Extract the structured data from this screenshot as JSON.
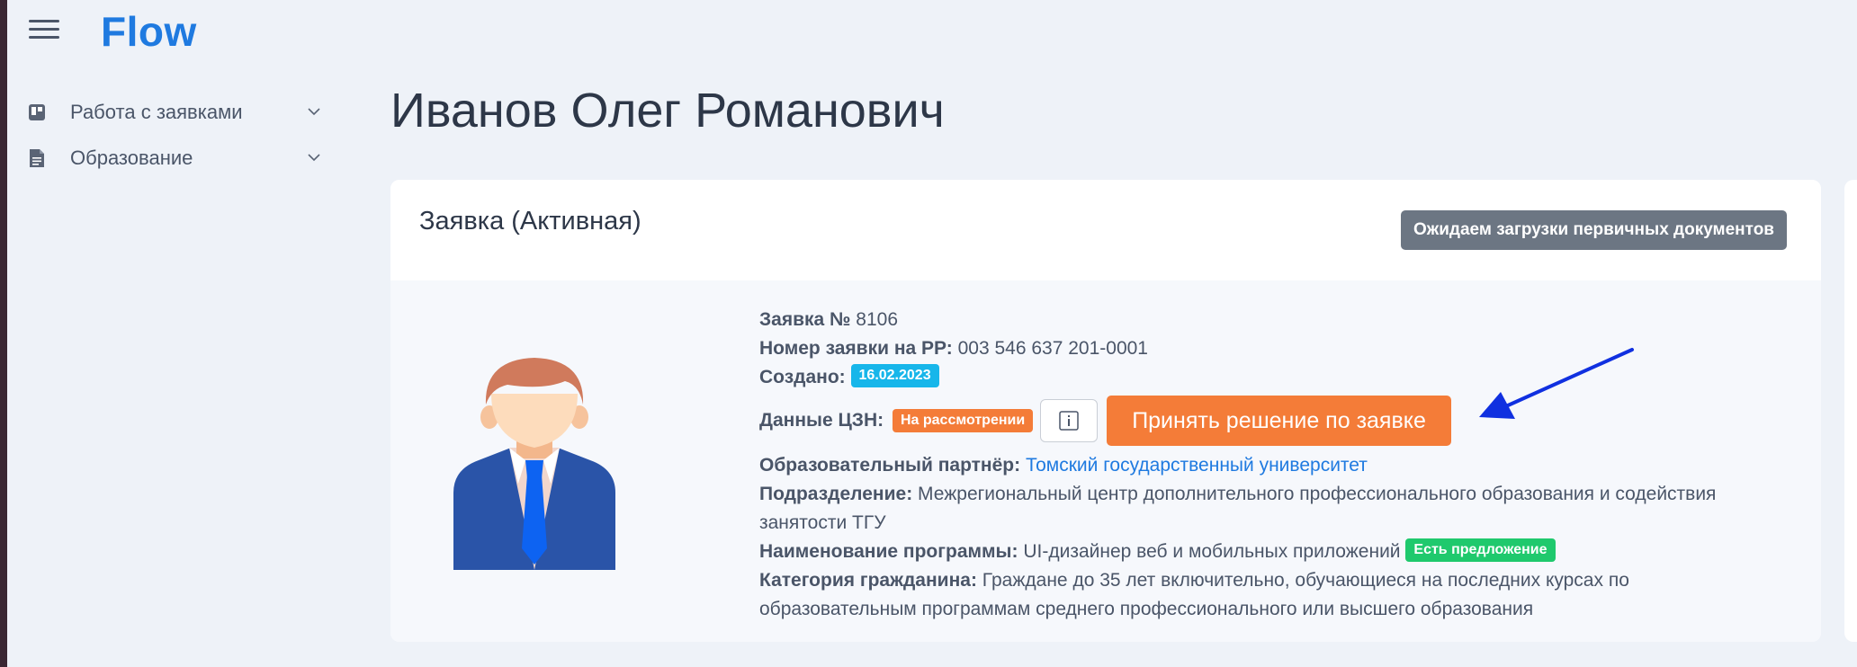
{
  "app": {
    "logo": "Flow"
  },
  "sidebar": {
    "items": [
      {
        "label": "Работа с заявками",
        "icon": "board-icon"
      },
      {
        "label": "Образование",
        "icon": "document-icon"
      }
    ]
  },
  "page": {
    "title": "Иванов Олег Романович"
  },
  "card": {
    "title": "Заявка (Активная)",
    "status": "Ожидаем загрузки первичных документов",
    "fields": {
      "application_number_label": "Заявка №",
      "application_number": "8106",
      "rr_number_label": "Номер заявки на РР:",
      "rr_number": "003 546 637 201-0001",
      "created_label": "Создано:",
      "created": "16.02.2023",
      "czn_label": "Данные ЦЗН:",
      "czn_status": "На рассмотрении",
      "decision_button": "Принять решение по заявке",
      "partner_label": "Образовательный партнёр:",
      "partner": "Томский государственный университет",
      "department_label": "Подразделение:",
      "department_line1": "Межрегиональный центр дополнительного профессионального образования и содействия",
      "department_line2": "занятости ТГУ",
      "program_label": "Наименование программы:",
      "program": "UI-дизайнер веб и мобильных приложений",
      "program_badge": "Есть предложение",
      "category_label": "Категория гражданина:",
      "category_line1": "Граждане до 35 лет включительно, обучающиеся на последних курсах по",
      "category_line2": "образовательным программам среднего профессионального или высшего образования"
    }
  },
  "colors": {
    "accent": "#1f7ae0",
    "orange": "#f47c38",
    "status_gray": "#6c7683",
    "date_badge": "#17b6ea",
    "offer_badge": "#1fc96d",
    "annotation_arrow": "#1030e0"
  }
}
